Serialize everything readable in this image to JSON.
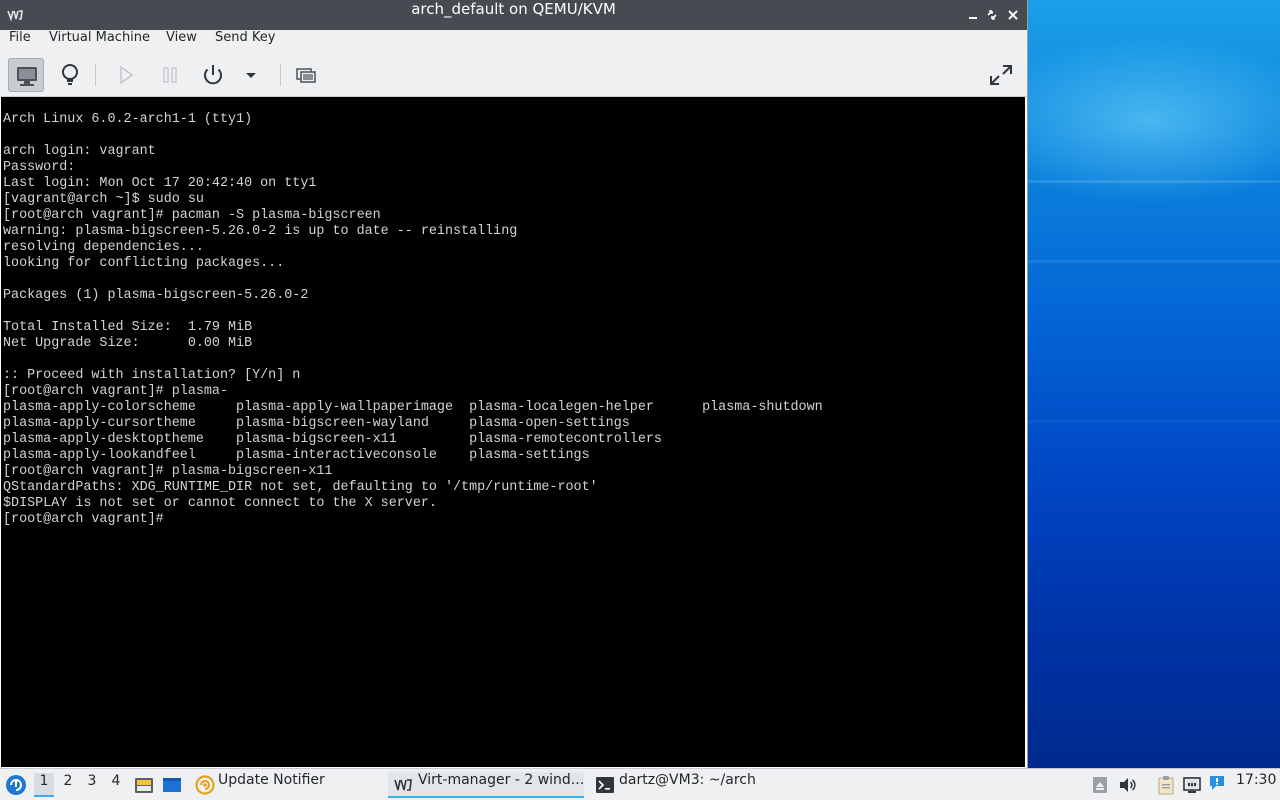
{
  "window": {
    "title": "arch_default on QEMU/KVM",
    "app_icon": "virt-manager-icon",
    "controls": {
      "minimize": "minimize-icon",
      "restore": "restore-icon",
      "close": "close-icon"
    }
  },
  "menu": {
    "items": [
      "File",
      "Virtual Machine",
      "View",
      "Send Key"
    ]
  },
  "toolbar": {
    "buttons": [
      {
        "name": "console-view",
        "icon": "monitor-icon",
        "active": true
      },
      {
        "name": "details-view",
        "icon": "lightbulb-icon",
        "active": false
      },
      {
        "name": "run",
        "icon": "play-icon",
        "enabled": false
      },
      {
        "name": "pause",
        "icon": "pause-icon",
        "enabled": false
      },
      {
        "name": "shutdown",
        "icon": "power-icon",
        "enabled": true
      },
      {
        "name": "shutdown-menu",
        "icon": "chevron-down-icon",
        "enabled": true
      },
      {
        "name": "snapshots",
        "icon": "snapshot-icon",
        "enabled": true
      },
      {
        "name": "fullscreen",
        "icon": "fullscreen-icon",
        "enabled": true
      }
    ]
  },
  "console": {
    "lines": [
      "Arch Linux 6.0.2-arch1-1 (tty1)",
      "",
      "arch login: vagrant",
      "Password:",
      "Last login: Mon Oct 17 20:42:40 on tty1",
      "[vagrant@arch ~]$ sudo su",
      "[root@arch vagrant]# pacman -S plasma-bigscreen",
      "warning: plasma-bigscreen-5.26.0-2 is up to date -- reinstalling",
      "resolving dependencies...",
      "looking for conflicting packages...",
      "",
      "Packages (1) plasma-bigscreen-5.26.0-2",
      "",
      "Total Installed Size:  1.79 MiB",
      "Net Upgrade Size:      0.00 MiB",
      "",
      ":: Proceed with installation? [Y/n] n",
      "[root@arch vagrant]# plasma-",
      "plasma-apply-colorscheme     plasma-apply-wallpaperimage  plasma-localegen-helper      plasma-shutdown",
      "plasma-apply-cursortheme     plasma-bigscreen-wayland     plasma-open-settings",
      "plasma-apply-desktoptheme    plasma-bigscreen-x11         plasma-remotecontrollers",
      "plasma-apply-lookandfeel     plasma-interactiveconsole    plasma-settings",
      "[root@arch vagrant]# plasma-bigscreen-x11",
      "QStandardPaths: XDG_RUNTIME_DIR not set, defaulting to '/tmp/runtime-root'",
      "$DISPLAY is not set or cannot connect to the X server.",
      "[root@arch vagrant]#"
    ]
  },
  "taskbar": {
    "start_icon": "start-menu-icon",
    "desktops": [
      "1",
      "2",
      "3",
      "4"
    ],
    "current_desktop": "1",
    "quicklaunch": [
      "file-manager-icon",
      "show-desktop-icon"
    ],
    "tasks": [
      {
        "icon": "update-notifier-icon",
        "label": "Update Notifier",
        "active": false
      },
      {
        "icon": "virt-manager-icon",
        "label": "Virt-manager - 2 wind...",
        "active": true
      },
      {
        "icon": "terminal-icon",
        "label": "dartz@VM3: ~/arch",
        "active": false
      }
    ],
    "tray": [
      "removable-media-icon",
      "volume-icon",
      "clipboard-icon",
      "network-icon",
      "notification-icon"
    ],
    "clock": "17:30"
  },
  "colors": {
    "titlebar": "#454b51",
    "menubar": "#eff0f1",
    "console_bg": "#000000",
    "console_fg": "#d4d4d4",
    "accent": "#3daee9",
    "wallpaper": "#0467d6"
  }
}
